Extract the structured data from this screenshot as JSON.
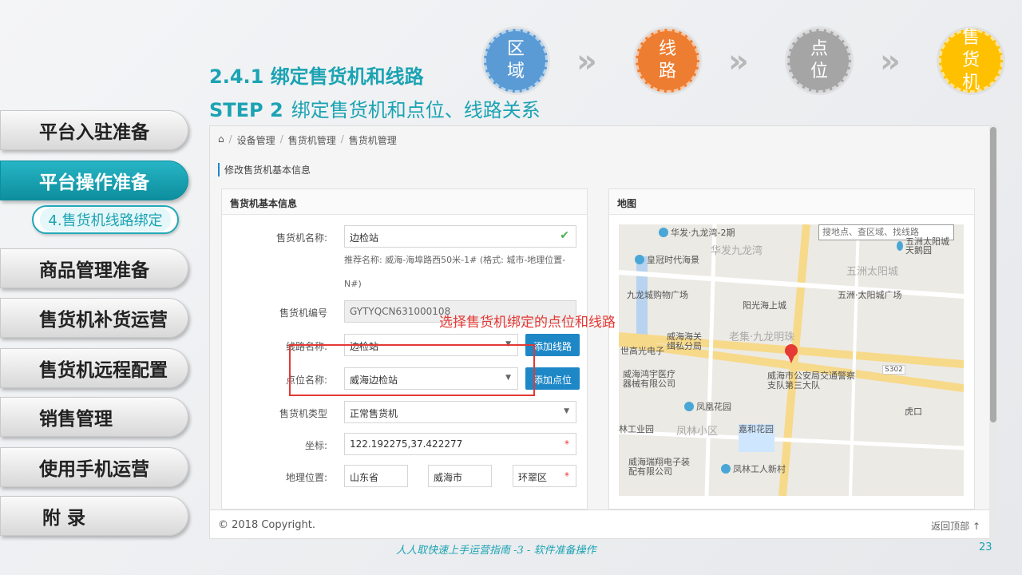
{
  "nav": {
    "items": [
      {
        "label": "平台入驻准备"
      },
      {
        "label": "平台操作准备"
      },
      {
        "label": "商品管理准备"
      },
      {
        "label": "售货机补货运营"
      },
      {
        "label": "售货机远程配置"
      },
      {
        "label": "销售管理"
      },
      {
        "label": "使用手机运营"
      },
      {
        "label": "附 录"
      }
    ],
    "sub_item": "4.售货机线路绑定"
  },
  "titles": {
    "main": "2.4.1 绑定售货机和线路",
    "step_prefix": "STEP 2",
    "step_text": "绑定售货机和点位、线路关系"
  },
  "flow": [
    {
      "label": "区域",
      "color": "#5b9bd5"
    },
    {
      "label": "线路",
      "color": "#ed7d31"
    },
    {
      "label": "点位",
      "color": "#a5a5a5"
    },
    {
      "label": "售货机",
      "color": "#ffc000"
    }
  ],
  "flow_arrow": "»",
  "app": {
    "breadcrumb": [
      "设备管理",
      "售货机管理",
      "售货机管理"
    ],
    "page_heading": "修改售货机基本信息",
    "form_panel_title": "售货机基本信息",
    "map_panel_title": "地图",
    "fields": {
      "name_label": "售货机名称:",
      "name_value": "边检站",
      "hint": "推荐名称: 威海-海埠路西50米-1# (格式: 城市-地理位置-N#)",
      "code_label": "售货机编号",
      "code_value": "GYTYQCN631000108",
      "route_label": "线路名称:",
      "route_value": "边检站",
      "point_label": "点位名称:",
      "point_value": "威海边检站",
      "type_label": "售货机类型",
      "type_value": "正常售货机",
      "coord_label": "坐标:",
      "coord_value": "122.192275,37.422277",
      "loc_label": "地理位置:",
      "province": "山东省",
      "city": "威海市",
      "district": "环翠区"
    },
    "buttons": {
      "add_route": "添加线路",
      "add_point": "添加点位"
    },
    "annotation": "选择售货机绑定的点位和线路",
    "footer": "© 2018 Copyright.",
    "to_top": "返回顶部",
    "map": {
      "search_placeholder": "搜地点、查区域、找线路",
      "labels": [
        "华发·九龙湾-2期",
        "华发九龙湾",
        "皇冠时代海景",
        "五洲太阳城天鹅园",
        "五洲太阳城",
        "五洲·太阳城广场",
        "九龙城购物广场",
        "阳光海上城",
        "威海海关缉私分局",
        "世高光电子",
        "老集·九龙明珠",
        "威海鸿宇医疗器械有限公司",
        "威海市公安局交通警察支队第三大队",
        "凤凰花园",
        "林工业园",
        "凤林小区",
        "嘉和花园",
        "虎口",
        "威海瑞翔电子装配有限公司",
        "凤林工人新村",
        "S302"
      ]
    }
  },
  "caption": "人人取快速上手运营指南 -3 - 软件准备操作",
  "page_number": "23"
}
